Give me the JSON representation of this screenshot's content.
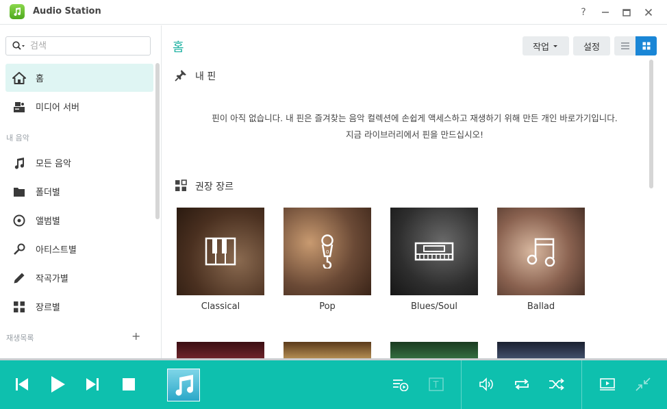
{
  "app": {
    "title": "Audio Station",
    "help_glyph": "?",
    "minimize_glyph": "—",
    "maximize_glyph": "□",
    "close_glyph": "✕"
  },
  "sidebar": {
    "search_placeholder": "검색",
    "items_top": [
      {
        "label": "홈",
        "icon": "home-icon",
        "active": true
      },
      {
        "label": "미디어 서버",
        "icon": "media-server-icon",
        "active": false
      }
    ],
    "my_music_label": "내 음악",
    "items_music": [
      {
        "label": "모든 음악",
        "icon": "music-note-icon"
      },
      {
        "label": "폴더별",
        "icon": "folder-icon"
      },
      {
        "label": "앨범별",
        "icon": "album-icon"
      },
      {
        "label": "아티스트별",
        "icon": "microphone-icon"
      },
      {
        "label": "작곡가별",
        "icon": "pen-icon"
      },
      {
        "label": "장르별",
        "icon": "genre-grid-icon"
      }
    ],
    "playlist_label": "재생목록",
    "add_glyph": "+"
  },
  "main": {
    "page_title": "홈",
    "action_button": "작업",
    "settings_button": "설정",
    "view_mode": "grid",
    "pins": {
      "title": "내 핀",
      "empty_line1": "핀이 아직 없습니다. 내 핀은 즐겨찾는 음악 컬렉션에 손쉽게 액세스하고 재생하기 위해 만든 개인 바로가기입니다.",
      "empty_line2": "지금 라이브러리에서 핀을 만드십시오!"
    },
    "genres": {
      "title": "권장 장르",
      "items": [
        {
          "label": "Classical",
          "icon": "piano-icon",
          "bg": "#5a3a2a"
        },
        {
          "label": "Pop",
          "icon": "microphone-icon",
          "bg": "#6b4a36"
        },
        {
          "label": "Blues/Soul",
          "icon": "keyboard-icon",
          "bg": "#2e2e2e"
        },
        {
          "label": "Ballad",
          "icon": "music-note-icon",
          "bg": "#8a6250"
        }
      ],
      "partial_bgs": [
        "#5a1e22",
        "#b88a4a",
        "#2e5a32",
        "#2a3548"
      ]
    }
  },
  "player": {
    "accent": "#0ec0ae",
    "now_playing_icon": "music-note-icon",
    "lyrics_glyph": "T"
  }
}
